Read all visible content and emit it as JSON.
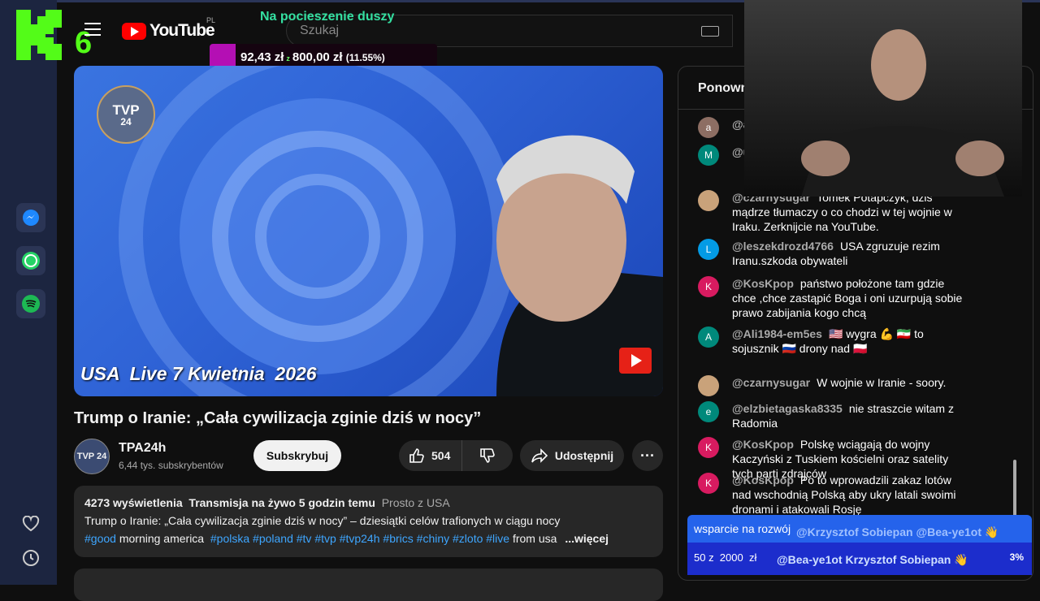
{
  "app": {
    "logo_letter": "K",
    "logo_number": "6"
  },
  "header": {
    "youtube_brand": "YouTube",
    "region": "PL",
    "search_placeholder": "Szukaj"
  },
  "overlay": {
    "banner_text": "Na pocieszenie duszy",
    "donation_current": "92,43 zł",
    "donation_separator": "z",
    "donation_goal": "800,00 zł",
    "donation_percent": "(11.55%)"
  },
  "video": {
    "caption": "USA  Live 7 Kwietnia  2026",
    "badge_line1": "TVP",
    "badge_line2": "24",
    "title": "Trump o Iranie: „Cała cywilizacja zginie dziś w nocy”"
  },
  "channel": {
    "name": "TPA24h",
    "subscribers": "6,44 tys. subskrybentów",
    "avatar_text": "TVP 24",
    "subscribe_label": "Subskrybuj"
  },
  "actions": {
    "likes": "504",
    "share_label": "Udostępnij",
    "more_label": "···"
  },
  "description": {
    "views": "4273 wyświetlenia",
    "streamed": "Transmisja na żywo 5 godzin temu",
    "source": "Prosto z USA",
    "line2": "Trump o Iranie: „Cała cywilizacja zginie dziś w nocy” – dziesiątki celów trafionych w ciągu nocy",
    "tags": [
      "#good",
      "#polska",
      "#poland",
      "#tv",
      "#tvp",
      "#tvp24h",
      "#brics",
      "#chiny",
      "#zloto",
      "#live"
    ],
    "tag_text_after_first": "morning america",
    "tail": "from usa",
    "more": "...więcej"
  },
  "chat": {
    "header": "Ponown",
    "messages": [
      {
        "avatar": "a",
        "color": "#8d6e63",
        "author": "@a",
        "text": ""
      },
      {
        "avatar": "M",
        "color": "#00897b",
        "author": "@u",
        "text": "😊"
      },
      {
        "avatar": "",
        "color": "#c9a27a",
        "author": "@czarnysugar",
        "text": "Tomek Potapczyk, dziś mądrze tłumaczy o co chodzi w tej wojnie w Iraku. Zerknijcie na YouTube."
      },
      {
        "avatar": "L",
        "color": "#039be5",
        "author": "@leszekdrozd4766",
        "text": "USA zgruzuje rezim Iranu.szkoda obywateli"
      },
      {
        "avatar": "K",
        "color": "#d81b60",
        "author": "@KosKpop",
        "text": "państwo położone tam gdzie chce ,chce zastąpić Boga i oni uzurpują sobie prawo zabijania kogo chcą"
      },
      {
        "avatar": "A",
        "color": "#00897b",
        "author": "@Ali1984-em5es",
        "text": "🇺🇸 wygra 💪 🇮🇷 to sojusznik 🇷🇺 drony nad 🇵🇱"
      },
      {
        "avatar": "",
        "color": "#c9a27a",
        "author": "@czarnysugar",
        "text": "W wojnie w Iranie - soory."
      },
      {
        "avatar": "e",
        "color": "#00897b",
        "author": "@elzbietagaska8335",
        "text": "nie straszcie witam z Radomia"
      },
      {
        "avatar": "K",
        "color": "#d81b60",
        "author": "@KosKpop",
        "text": "Polskę wciągają do wojny Kaczyński z Tuskiem kościelni oraz satelity tych parti zdrajców"
      },
      {
        "avatar": "K",
        "color": "#d81b60",
        "author": "@KosKpop",
        "text": "Po to wprowadzili zakaz lotów nad wschodnią Polską aby ukry latali swoimi dronami i atakowali Rosję"
      }
    ],
    "banner1_label": "wsparcie na rozwój",
    "banner1_names": "@Krzysztof Sobiepan   @Bea-ye1ot  👋",
    "banner2_amount": "50 z  2000  zł",
    "banner2_names": "@Bea-ye1ot   Krzysztof Sobiepan  👋",
    "banner2_percent": "3%"
  },
  "colors": {
    "accent_green": "#34e0a1",
    "youtube_red": "#ff0000",
    "link_blue": "#3ea6ff",
    "rail_bg": "#1c2540"
  }
}
